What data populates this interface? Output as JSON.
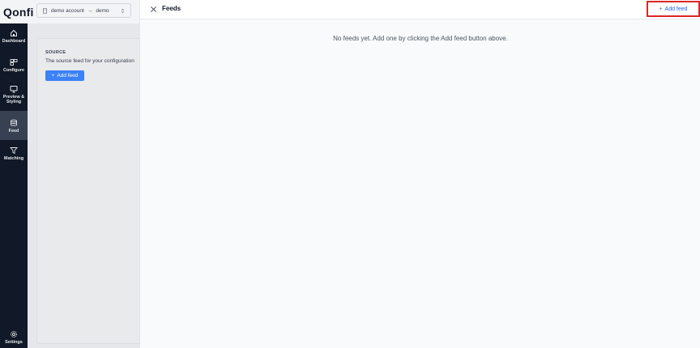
{
  "brand": {
    "logo_text": "Qonfi"
  },
  "account": {
    "account": "demo account",
    "project": "demo",
    "separator": "→"
  },
  "sidebar": {
    "items": [
      {
        "label": "Dashboard",
        "icon": "home-icon"
      },
      {
        "label": "Configure",
        "icon": "configure-icon"
      },
      {
        "label": "Preview & Styling",
        "icon": "monitor-icon"
      },
      {
        "label": "Feed",
        "icon": "database-icon",
        "active": true
      },
      {
        "label": "Matching",
        "icon": "funnel-icon"
      },
      {
        "label": "Settings",
        "icon": "gear-icon"
      }
    ]
  },
  "source": {
    "heading": "SOURCE",
    "description": "The source feed for your configuration",
    "add_button": "Add feed"
  },
  "feeds_panel": {
    "title": "Feeds",
    "add_button": "Add feed",
    "empty_message": "No feeds yet. Add one by clicking the Add feed button above."
  },
  "colors": {
    "sidebar_bg": "#111827",
    "accent": "#3b82f6",
    "highlight": "#dc2626"
  }
}
